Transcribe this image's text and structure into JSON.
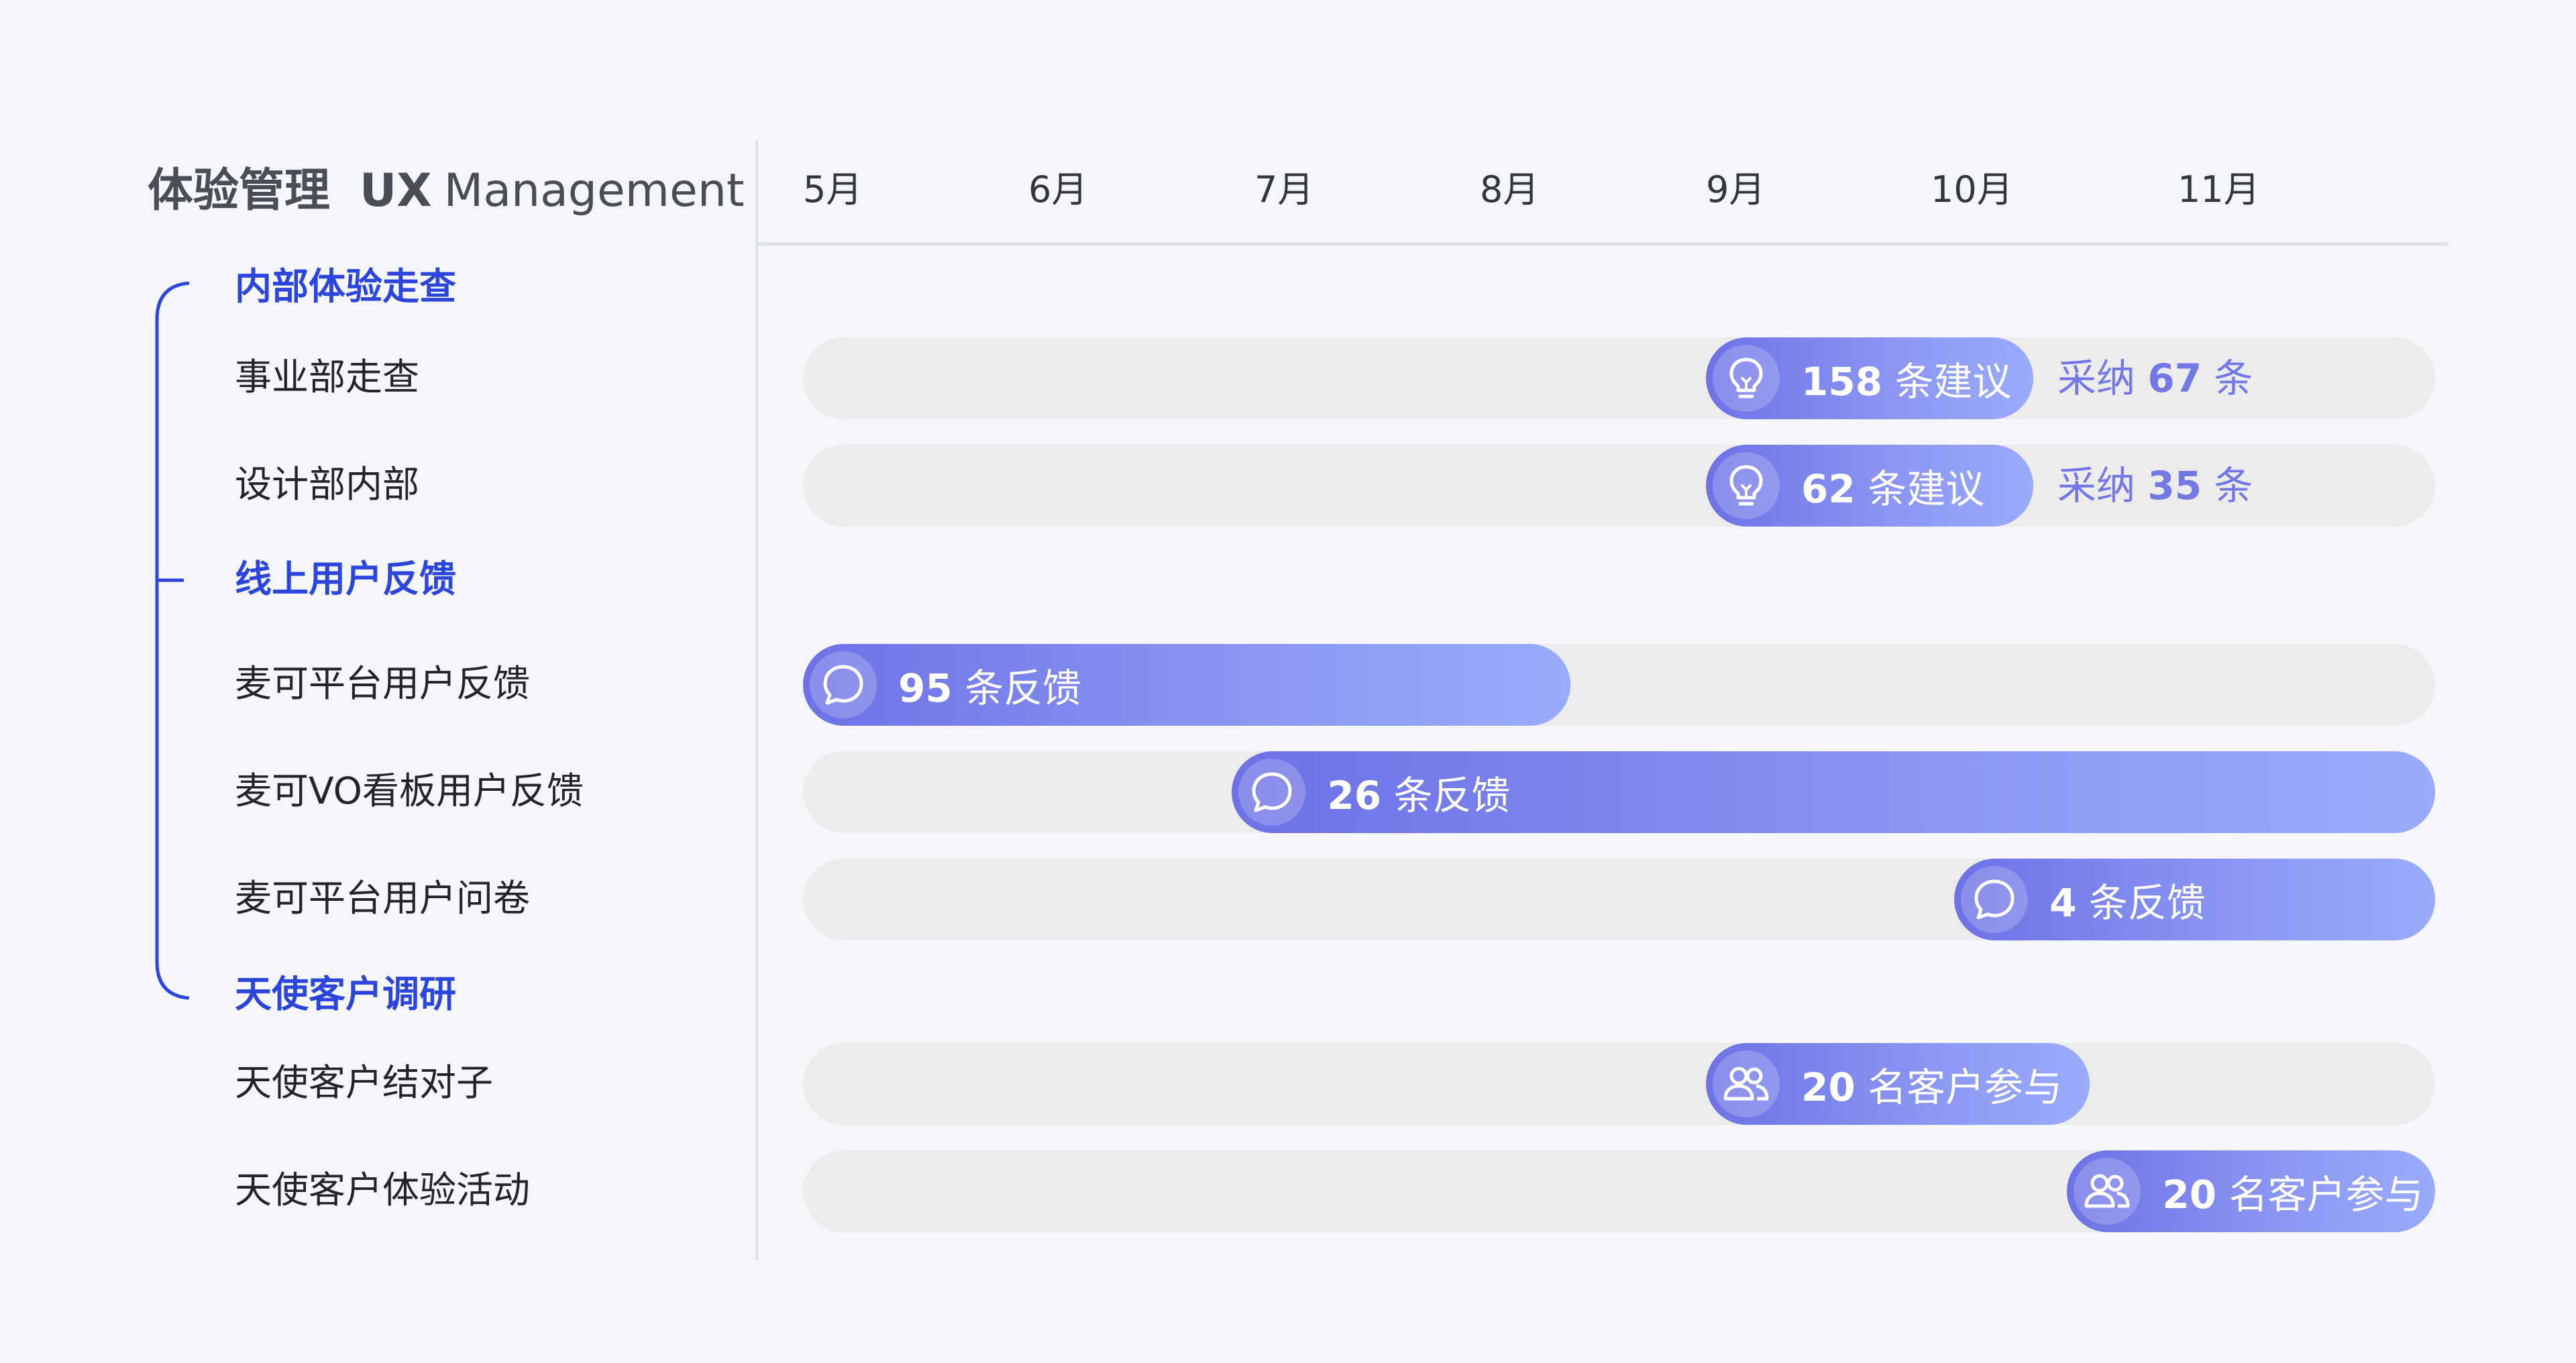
{
  "title": {
    "zh": "体验管理",
    "ux": "UX",
    "en": "Management"
  },
  "months": [
    "5月",
    "6月",
    "7月",
    "8月",
    "9月",
    "10月",
    "11月"
  ],
  "categories": [
    "内部体验走查",
    "线上用户反馈",
    "天使客户调研"
  ],
  "rows": [
    "事业部走查",
    "设计部内部",
    "麦可平台用户反馈",
    "麦可VO看板用户反馈",
    "麦可平台用户问卷",
    "天使客户结对子",
    "天使客户体验活动"
  ],
  "bars": [
    {
      "row": "事业部走查",
      "icon": "lightbulb-icon",
      "number": "158",
      "unit": "条建议",
      "adopt_prefix": "采纳",
      "adopt_number": "67",
      "adopt_unit": "条"
    },
    {
      "row": "设计部内部",
      "icon": "lightbulb-icon",
      "number": "62",
      "unit": "条建议",
      "adopt_prefix": "采纳",
      "adopt_number": "35",
      "adopt_unit": "条"
    },
    {
      "row": "麦可平台用户反馈",
      "icon": "chat-bubble-icon",
      "number": "95",
      "unit": "条反馈"
    },
    {
      "row": "麦可VO看板用户反馈",
      "icon": "chat-bubble-icon",
      "number": "26",
      "unit": "条反馈"
    },
    {
      "row": "麦可平台用户问卷",
      "icon": "chat-bubble-icon",
      "number": "4",
      "unit": "条反馈"
    },
    {
      "row": "天使客户结对子",
      "icon": "users-icon",
      "number": "20",
      "unit": "名客户参与"
    },
    {
      "row": "天使客户体验活动",
      "icon": "users-icon",
      "number": "20",
      "unit": "名客户参与"
    }
  ],
  "colors": {
    "accent": "#2b45dd",
    "bar_start": "#6d72e6",
    "bar_end": "#9aabfb",
    "track": "#ececec",
    "adopt_text": "#7478e4"
  },
  "chart_data": {
    "type": "gantt",
    "axis": "月",
    "ticks": [
      "5月",
      "6月",
      "7月",
      "8月",
      "9月",
      "10月",
      "11月"
    ],
    "tasks": [
      {
        "group": "内部体验走查",
        "name": "事业部走查",
        "start": 9.0,
        "end": 10.45,
        "label": "158 条建议",
        "note": "采纳 67 条"
      },
      {
        "group": "内部体验走查",
        "name": "设计部内部",
        "start": 9.0,
        "end": 10.45,
        "label": "62 条建议",
        "note": "采纳 35 条"
      },
      {
        "group": "线上用户反馈",
        "name": "麦可平台用户反馈",
        "start": 5.0,
        "end": 8.4,
        "label": "95 条反馈"
      },
      {
        "group": "线上用户反馈",
        "name": "麦可VO看板用户反馈",
        "start": 6.9,
        "end": 12.25,
        "label": "26 条反馈"
      },
      {
        "group": "线上用户反馈",
        "name": "麦可平台用户问卷",
        "start": 10.1,
        "end": 12.25,
        "label": "4 条反馈"
      },
      {
        "group": "天使客户调研",
        "name": "天使客户结对子",
        "start": 9.0,
        "end": 10.7,
        "label": "20 名客户参与"
      },
      {
        "group": "天使客户调研",
        "name": "天使客户体验活动",
        "start": 10.6,
        "end": 12.25,
        "label": "20 名客户参与"
      }
    ]
  }
}
